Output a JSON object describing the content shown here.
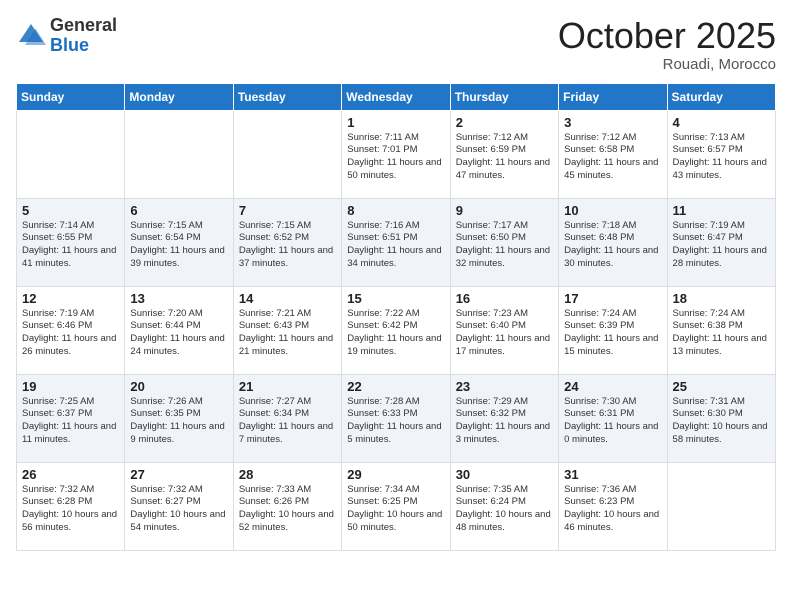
{
  "logo": {
    "general": "General",
    "blue": "Blue"
  },
  "header": {
    "month": "October 2025",
    "location": "Rouadi, Morocco"
  },
  "weekdays": [
    "Sunday",
    "Monday",
    "Tuesday",
    "Wednesday",
    "Thursday",
    "Friday",
    "Saturday"
  ],
  "weeks": [
    [
      {
        "date": "",
        "info": ""
      },
      {
        "date": "",
        "info": ""
      },
      {
        "date": "",
        "info": ""
      },
      {
        "date": "1",
        "info": "Sunrise: 7:11 AM\nSunset: 7:01 PM\nDaylight: 11 hours and 50 minutes."
      },
      {
        "date": "2",
        "info": "Sunrise: 7:12 AM\nSunset: 6:59 PM\nDaylight: 11 hours and 47 minutes."
      },
      {
        "date": "3",
        "info": "Sunrise: 7:12 AM\nSunset: 6:58 PM\nDaylight: 11 hours and 45 minutes."
      },
      {
        "date": "4",
        "info": "Sunrise: 7:13 AM\nSunset: 6:57 PM\nDaylight: 11 hours and 43 minutes."
      }
    ],
    [
      {
        "date": "5",
        "info": "Sunrise: 7:14 AM\nSunset: 6:55 PM\nDaylight: 11 hours and 41 minutes."
      },
      {
        "date": "6",
        "info": "Sunrise: 7:15 AM\nSunset: 6:54 PM\nDaylight: 11 hours and 39 minutes."
      },
      {
        "date": "7",
        "info": "Sunrise: 7:15 AM\nSunset: 6:52 PM\nDaylight: 11 hours and 37 minutes."
      },
      {
        "date": "8",
        "info": "Sunrise: 7:16 AM\nSunset: 6:51 PM\nDaylight: 11 hours and 34 minutes."
      },
      {
        "date": "9",
        "info": "Sunrise: 7:17 AM\nSunset: 6:50 PM\nDaylight: 11 hours and 32 minutes."
      },
      {
        "date": "10",
        "info": "Sunrise: 7:18 AM\nSunset: 6:48 PM\nDaylight: 11 hours and 30 minutes."
      },
      {
        "date": "11",
        "info": "Sunrise: 7:19 AM\nSunset: 6:47 PM\nDaylight: 11 hours and 28 minutes."
      }
    ],
    [
      {
        "date": "12",
        "info": "Sunrise: 7:19 AM\nSunset: 6:46 PM\nDaylight: 11 hours and 26 minutes."
      },
      {
        "date": "13",
        "info": "Sunrise: 7:20 AM\nSunset: 6:44 PM\nDaylight: 11 hours and 24 minutes."
      },
      {
        "date": "14",
        "info": "Sunrise: 7:21 AM\nSunset: 6:43 PM\nDaylight: 11 hours and 21 minutes."
      },
      {
        "date": "15",
        "info": "Sunrise: 7:22 AM\nSunset: 6:42 PM\nDaylight: 11 hours and 19 minutes."
      },
      {
        "date": "16",
        "info": "Sunrise: 7:23 AM\nSunset: 6:40 PM\nDaylight: 11 hours and 17 minutes."
      },
      {
        "date": "17",
        "info": "Sunrise: 7:24 AM\nSunset: 6:39 PM\nDaylight: 11 hours and 15 minutes."
      },
      {
        "date": "18",
        "info": "Sunrise: 7:24 AM\nSunset: 6:38 PM\nDaylight: 11 hours and 13 minutes."
      }
    ],
    [
      {
        "date": "19",
        "info": "Sunrise: 7:25 AM\nSunset: 6:37 PM\nDaylight: 11 hours and 11 minutes."
      },
      {
        "date": "20",
        "info": "Sunrise: 7:26 AM\nSunset: 6:35 PM\nDaylight: 11 hours and 9 minutes."
      },
      {
        "date": "21",
        "info": "Sunrise: 7:27 AM\nSunset: 6:34 PM\nDaylight: 11 hours and 7 minutes."
      },
      {
        "date": "22",
        "info": "Sunrise: 7:28 AM\nSunset: 6:33 PM\nDaylight: 11 hours and 5 minutes."
      },
      {
        "date": "23",
        "info": "Sunrise: 7:29 AM\nSunset: 6:32 PM\nDaylight: 11 hours and 3 minutes."
      },
      {
        "date": "24",
        "info": "Sunrise: 7:30 AM\nSunset: 6:31 PM\nDaylight: 11 hours and 0 minutes."
      },
      {
        "date": "25",
        "info": "Sunrise: 7:31 AM\nSunset: 6:30 PM\nDaylight: 10 hours and 58 minutes."
      }
    ],
    [
      {
        "date": "26",
        "info": "Sunrise: 7:32 AM\nSunset: 6:28 PM\nDaylight: 10 hours and 56 minutes."
      },
      {
        "date": "27",
        "info": "Sunrise: 7:32 AM\nSunset: 6:27 PM\nDaylight: 10 hours and 54 minutes."
      },
      {
        "date": "28",
        "info": "Sunrise: 7:33 AM\nSunset: 6:26 PM\nDaylight: 10 hours and 52 minutes."
      },
      {
        "date": "29",
        "info": "Sunrise: 7:34 AM\nSunset: 6:25 PM\nDaylight: 10 hours and 50 minutes."
      },
      {
        "date": "30",
        "info": "Sunrise: 7:35 AM\nSunset: 6:24 PM\nDaylight: 10 hours and 48 minutes."
      },
      {
        "date": "31",
        "info": "Sunrise: 7:36 AM\nSunset: 6:23 PM\nDaylight: 10 hours and 46 minutes."
      },
      {
        "date": "",
        "info": ""
      }
    ]
  ]
}
